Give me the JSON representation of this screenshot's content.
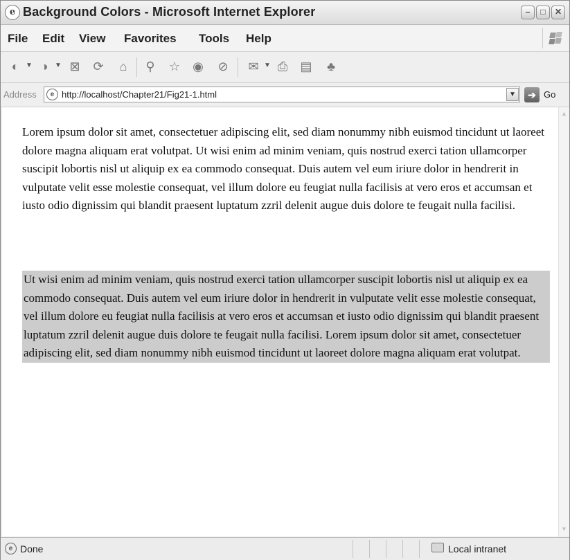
{
  "window": {
    "title": "Background Colors - Microsoft Internet Explorer",
    "controls": {
      "minimize": "–",
      "maximize": "□",
      "close": "✕"
    }
  },
  "menu": {
    "items": [
      "File",
      "Edit",
      "View",
      "Favorites",
      "Tools",
      "Help"
    ]
  },
  "toolbar": {
    "buttons": [
      "back-icon",
      "forward-icon",
      "stop-icon",
      "refresh-icon",
      "home-icon",
      "search-icon",
      "favorites-icon",
      "media-icon",
      "history-icon",
      "mail-icon",
      "print-icon",
      "edit-icon",
      "messenger-icon"
    ]
  },
  "address": {
    "label": "Address",
    "url": "http://localhost/Chapter21/Fig21-1.html",
    "go_label": "Go"
  },
  "content": {
    "paragraph1": "Lorem ipsum dolor sit amet, consectetuer adipiscing elit, sed diam nonummy nibh euismod tincidunt ut laoreet dolore magna aliquam erat volutpat. Ut wisi enim ad minim veniam, quis nostrud exerci tation ullamcorper suscipit lobortis nisl ut aliquip ex ea commodo consequat. Duis autem vel eum iriure dolor in hendrerit in vulputate velit esse molestie consequat, vel illum dolore eu feugiat nulla facilisis at vero eros et accumsan et iusto odio dignissim qui blandit praesent luptatum zzril delenit augue duis dolore te feugait nulla facilisi.",
    "paragraph2": "Ut wisi enim ad minim veniam, quis nostrud exerci tation ullamcorper suscipit lobortis nisl ut aliquip ex ea commodo consequat. Duis autem vel eum iriure dolor in hendrerit in vulputate velit esse molestie consequat, vel illum dolore eu feugiat nulla facilisis at vero eros et accumsan et iusto odio dignissim qui blandit praesent luptatum zzril delenit augue duis dolore te feugait nulla facilisi. Lorem ipsum dolor sit amet, consectetuer adipiscing elit, sed diam nonummy nibh euismod tincidunt ut laoreet dolore magna aliquam erat volutpat.",
    "paragraph2_background": "#cccccc"
  },
  "status": {
    "text": "Done",
    "zone": "Local intranet"
  }
}
